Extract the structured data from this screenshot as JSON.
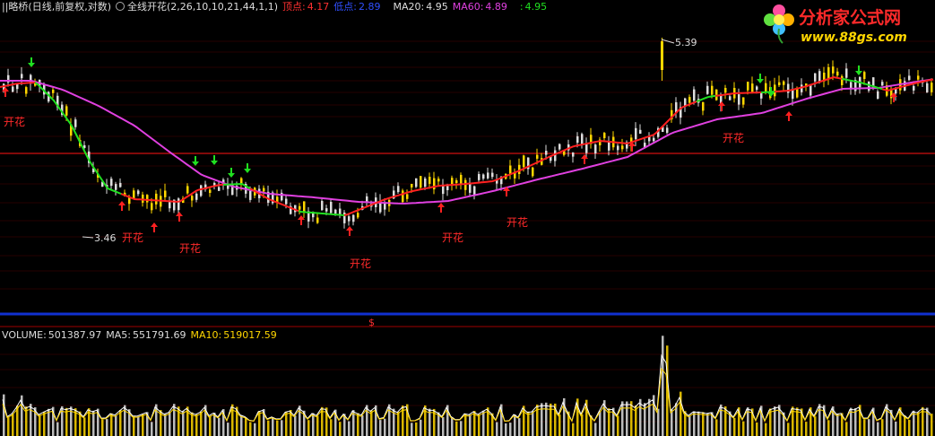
{
  "header": {
    "stock_label": "||略桥(日线,前复权,对数)",
    "indicator_icon": "circle-icon",
    "indicator_label": "全线开花(2,26,10,10,21,44,1,1)",
    "top_label": "顶点:",
    "top_value": "4.17",
    "bottom_label": "低点:",
    "bottom_value": "2.89",
    "ma20_label": "MA20:",
    "ma20_value": "4.95",
    "ma60_label": "MA60:",
    "ma60_value": "4.89",
    "last_label": ":",
    "last_value": "4.95"
  },
  "logo": {
    "title": "分析家公式网",
    "url": "www.88gs.com"
  },
  "divider_marker": "$",
  "volume_header": {
    "volume_label": "VOLUME:",
    "volume_value": "501387.97",
    "ma5_label": "MA5:",
    "ma5_value": "551791.69",
    "ma10_label": "MA10:",
    "ma10_value": "519017.59"
  },
  "colors": {
    "up": "#ffd700",
    "down": "#dddddd",
    "ma_short": "#ff2020",
    "ma_short_alt": "#20e020",
    "ma_long": "#e040e0",
    "buy_arrow": "#ff2020",
    "sell_arrow": "#20e020",
    "grid": "#8b0000",
    "divider_blue": "#1030d0",
    "reference": "#d01010"
  },
  "chart_data": {
    "type": "candlestick",
    "scale": "log",
    "ylim": [
      3.2,
      5.55
    ],
    "reference_line": 4.17,
    "annotations": [
      {
        "text": "5.39",
        "kind": "high"
      },
      {
        "text": "3.46",
        "kind": "low"
      }
    ],
    "signal_label": "开花",
    "signal_labels_count": 8,
    "buy_arrow_count": 14,
    "sell_arrow_count": 8,
    "volume_series": [
      "VOLUME",
      "MA5",
      "MA10"
    ]
  }
}
